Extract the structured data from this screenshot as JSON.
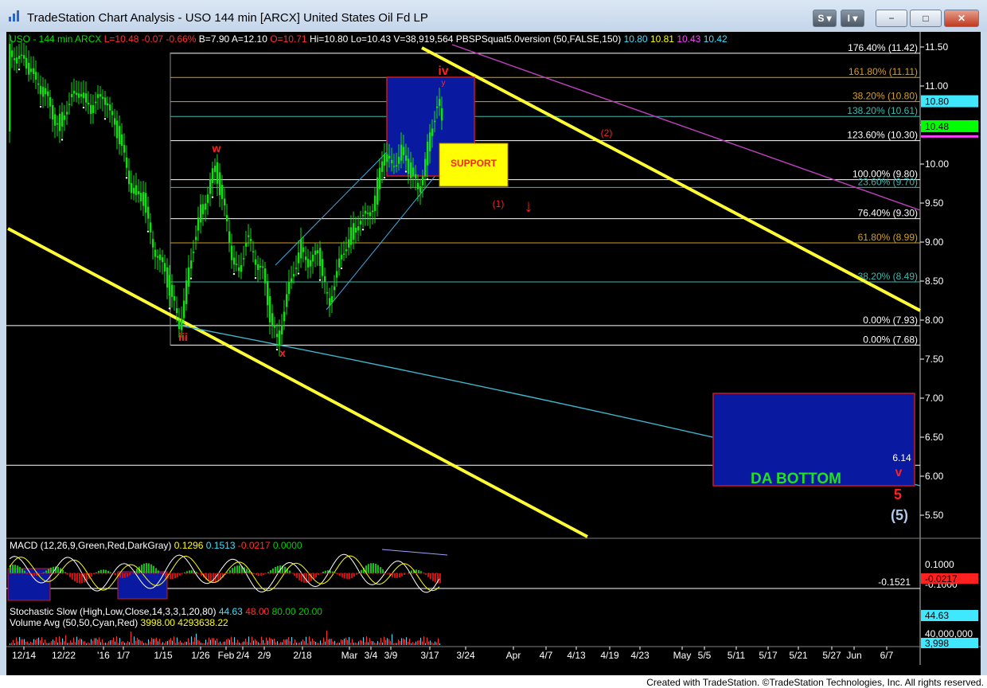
{
  "window": {
    "title": "TradeStation Chart Analysis - USO 144 min [ARCX] United States Oil Fd LP",
    "buttons": {
      "s_label": "S",
      "i_label": "I",
      "minimize": "−",
      "maximize": "□",
      "close": "✕"
    }
  },
  "header": {
    "items": [
      {
        "text": "USO - 144 min  ARCX",
        "color": "#00e000"
      },
      {
        "text": "L=10.48",
        "color": "#ff3030"
      },
      {
        "text": "-0.07",
        "color": "#ff3030"
      },
      {
        "text": "-0.66%",
        "color": "#ff3030"
      },
      {
        "text": "B=7.90",
        "color": "#ffffff"
      },
      {
        "text": "A=12.10",
        "color": "#ffffff"
      },
      {
        "text": "O=10.71",
        "color": "#ff3030"
      },
      {
        "text": "Hi=10.80",
        "color": "#ffffff"
      },
      {
        "text": "Lo=10.43",
        "color": "#ffffff"
      },
      {
        "text": "V=38,919,564",
        "color": "#ffffff"
      },
      {
        "text": "PBSPSquat5.0version (50,FALSE,150)",
        "color": "#ffffff"
      },
      {
        "text": "10.80",
        "color": "#40e0ff"
      },
      {
        "text": "10.81",
        "color": "#ffff00"
      },
      {
        "text": "10.43",
        "color": "#ff40ff"
      },
      {
        "text": "10.42",
        "color": "#40e0ff"
      }
    ]
  },
  "annotations": {
    "support": "SUPPORT",
    "da_bottom": "DA BOTTOM",
    "wave_iv": "iv",
    "wave_y": "y",
    "wave_w": "w",
    "wave_x": "x",
    "wave_iii": "iii",
    "wave_1": "(1)",
    "wave_2": "(2)",
    "wave_v": "v",
    "wave_5": "5",
    "wave_5p": "(5)",
    "val_614": "6.14",
    "arrow": "↓"
  },
  "chart_data": [
    {
      "type": "candlestick",
      "title": "USO - 144 min ARCX",
      "ylim": [
        5.25,
        11.6
      ],
      "price_ticks": [
        "11.50",
        "11.00",
        "10.50",
        "10.00",
        "9.50",
        "9.00",
        "8.50",
        "8.00",
        "7.50",
        "7.00",
        "6.50",
        "6.00",
        "5.50"
      ],
      "x_labels": [
        "12/14",
        "12/22",
        "'16",
        "1/7",
        "1/15",
        "1/26",
        "Feb",
        "2/4",
        "2/9",
        "2/18",
        "Mar",
        "3/4",
        "3/9",
        "3/17",
        "3/24",
        "Apr",
        "4/7",
        "4/13",
        "4/19",
        "4/23",
        "May",
        "5/5",
        "5/11",
        "5/17",
        "5/21",
        "5/27",
        "Jun",
        "6/7"
      ],
      "fib_levels": [
        {
          "label": "176.40% (11.42)",
          "value": 11.42,
          "color": "#ffffff"
        },
        {
          "label": "161.80% (11.11)",
          "value": 11.11,
          "color": "#d4a020"
        },
        {
          "label": "38.20% (10.80)",
          "value": 10.8,
          "color": "#d4a020"
        },
        {
          "label": "138.20% (10.61)",
          "value": 10.61,
          "color": "#3fb8b0"
        },
        {
          "label": "123.60% (10.30)",
          "value": 10.3,
          "color": "#ffffff"
        },
        {
          "label": "100.00% (9.80)",
          "value": 9.8,
          "color": "#ffffff"
        },
        {
          "label": "23.60% (9.70)",
          "value": 9.7,
          "color": "#3fb8b0"
        },
        {
          "label": "76.40% (9.30)",
          "value": 9.3,
          "color": "#ffffff"
        },
        {
          "label": "61.80% (8.99)",
          "value": 8.99,
          "color": "#d4a020"
        },
        {
          "label": "38.20% (8.49)",
          "value": 8.49,
          "color": "#3fb8b0"
        },
        {
          "label": "0.00% (7.93)",
          "value": 7.93,
          "color": "#ffffff"
        },
        {
          "label": "0.00% (7.68)",
          "value": 7.68,
          "color": "#ffffff"
        }
      ],
      "last_price_tags": [
        {
          "text": "10.80",
          "value": 10.8,
          "color": "#40e8ff"
        },
        {
          "text": "10.48",
          "value": 10.48,
          "color": "#00ff00"
        }
      ]
    },
    {
      "type": "line",
      "title": "MACD (12,26,9,Green,Red,DarkGray)",
      "readouts": [
        {
          "text": "0.1296",
          "color": "#ffff00"
        },
        {
          "text": "0.1513",
          "color": "#40e0ff"
        },
        {
          "text": "-0.0217",
          "color": "#ff3030"
        },
        {
          "text": "0.0000",
          "color": "#00d000"
        }
      ],
      "ticks": [
        "0.1000",
        "-0.1000"
      ],
      "ref_value": "-0.1521",
      "tag": "-0.0217"
    },
    {
      "type": "line",
      "title": "Stochastic Slow (High,Low,Close,14,3,3,1,20,80)",
      "readouts": [
        {
          "text": "44.63",
          "color": "#40e0ff"
        },
        {
          "text": "48.00",
          "color": "#ff3030"
        },
        {
          "text": "80.00",
          "color": "#00d000"
        },
        {
          "text": "20.00",
          "color": "#00d000"
        }
      ],
      "tag": "44.63"
    },
    {
      "type": "bar",
      "title": "Volume Avg (50,50,Cyan,Red)",
      "readouts": [
        {
          "text": "3998.00",
          "color": "#ffff00"
        },
        {
          "text": "4293638.22",
          "color": "#ffff00"
        }
      ],
      "tick": "40,000,000",
      "tag": "3,998"
    }
  ],
  "footer": {
    "text": "Created with TradeStation. ©TradeStation Technologies, Inc. All rights reserved."
  }
}
